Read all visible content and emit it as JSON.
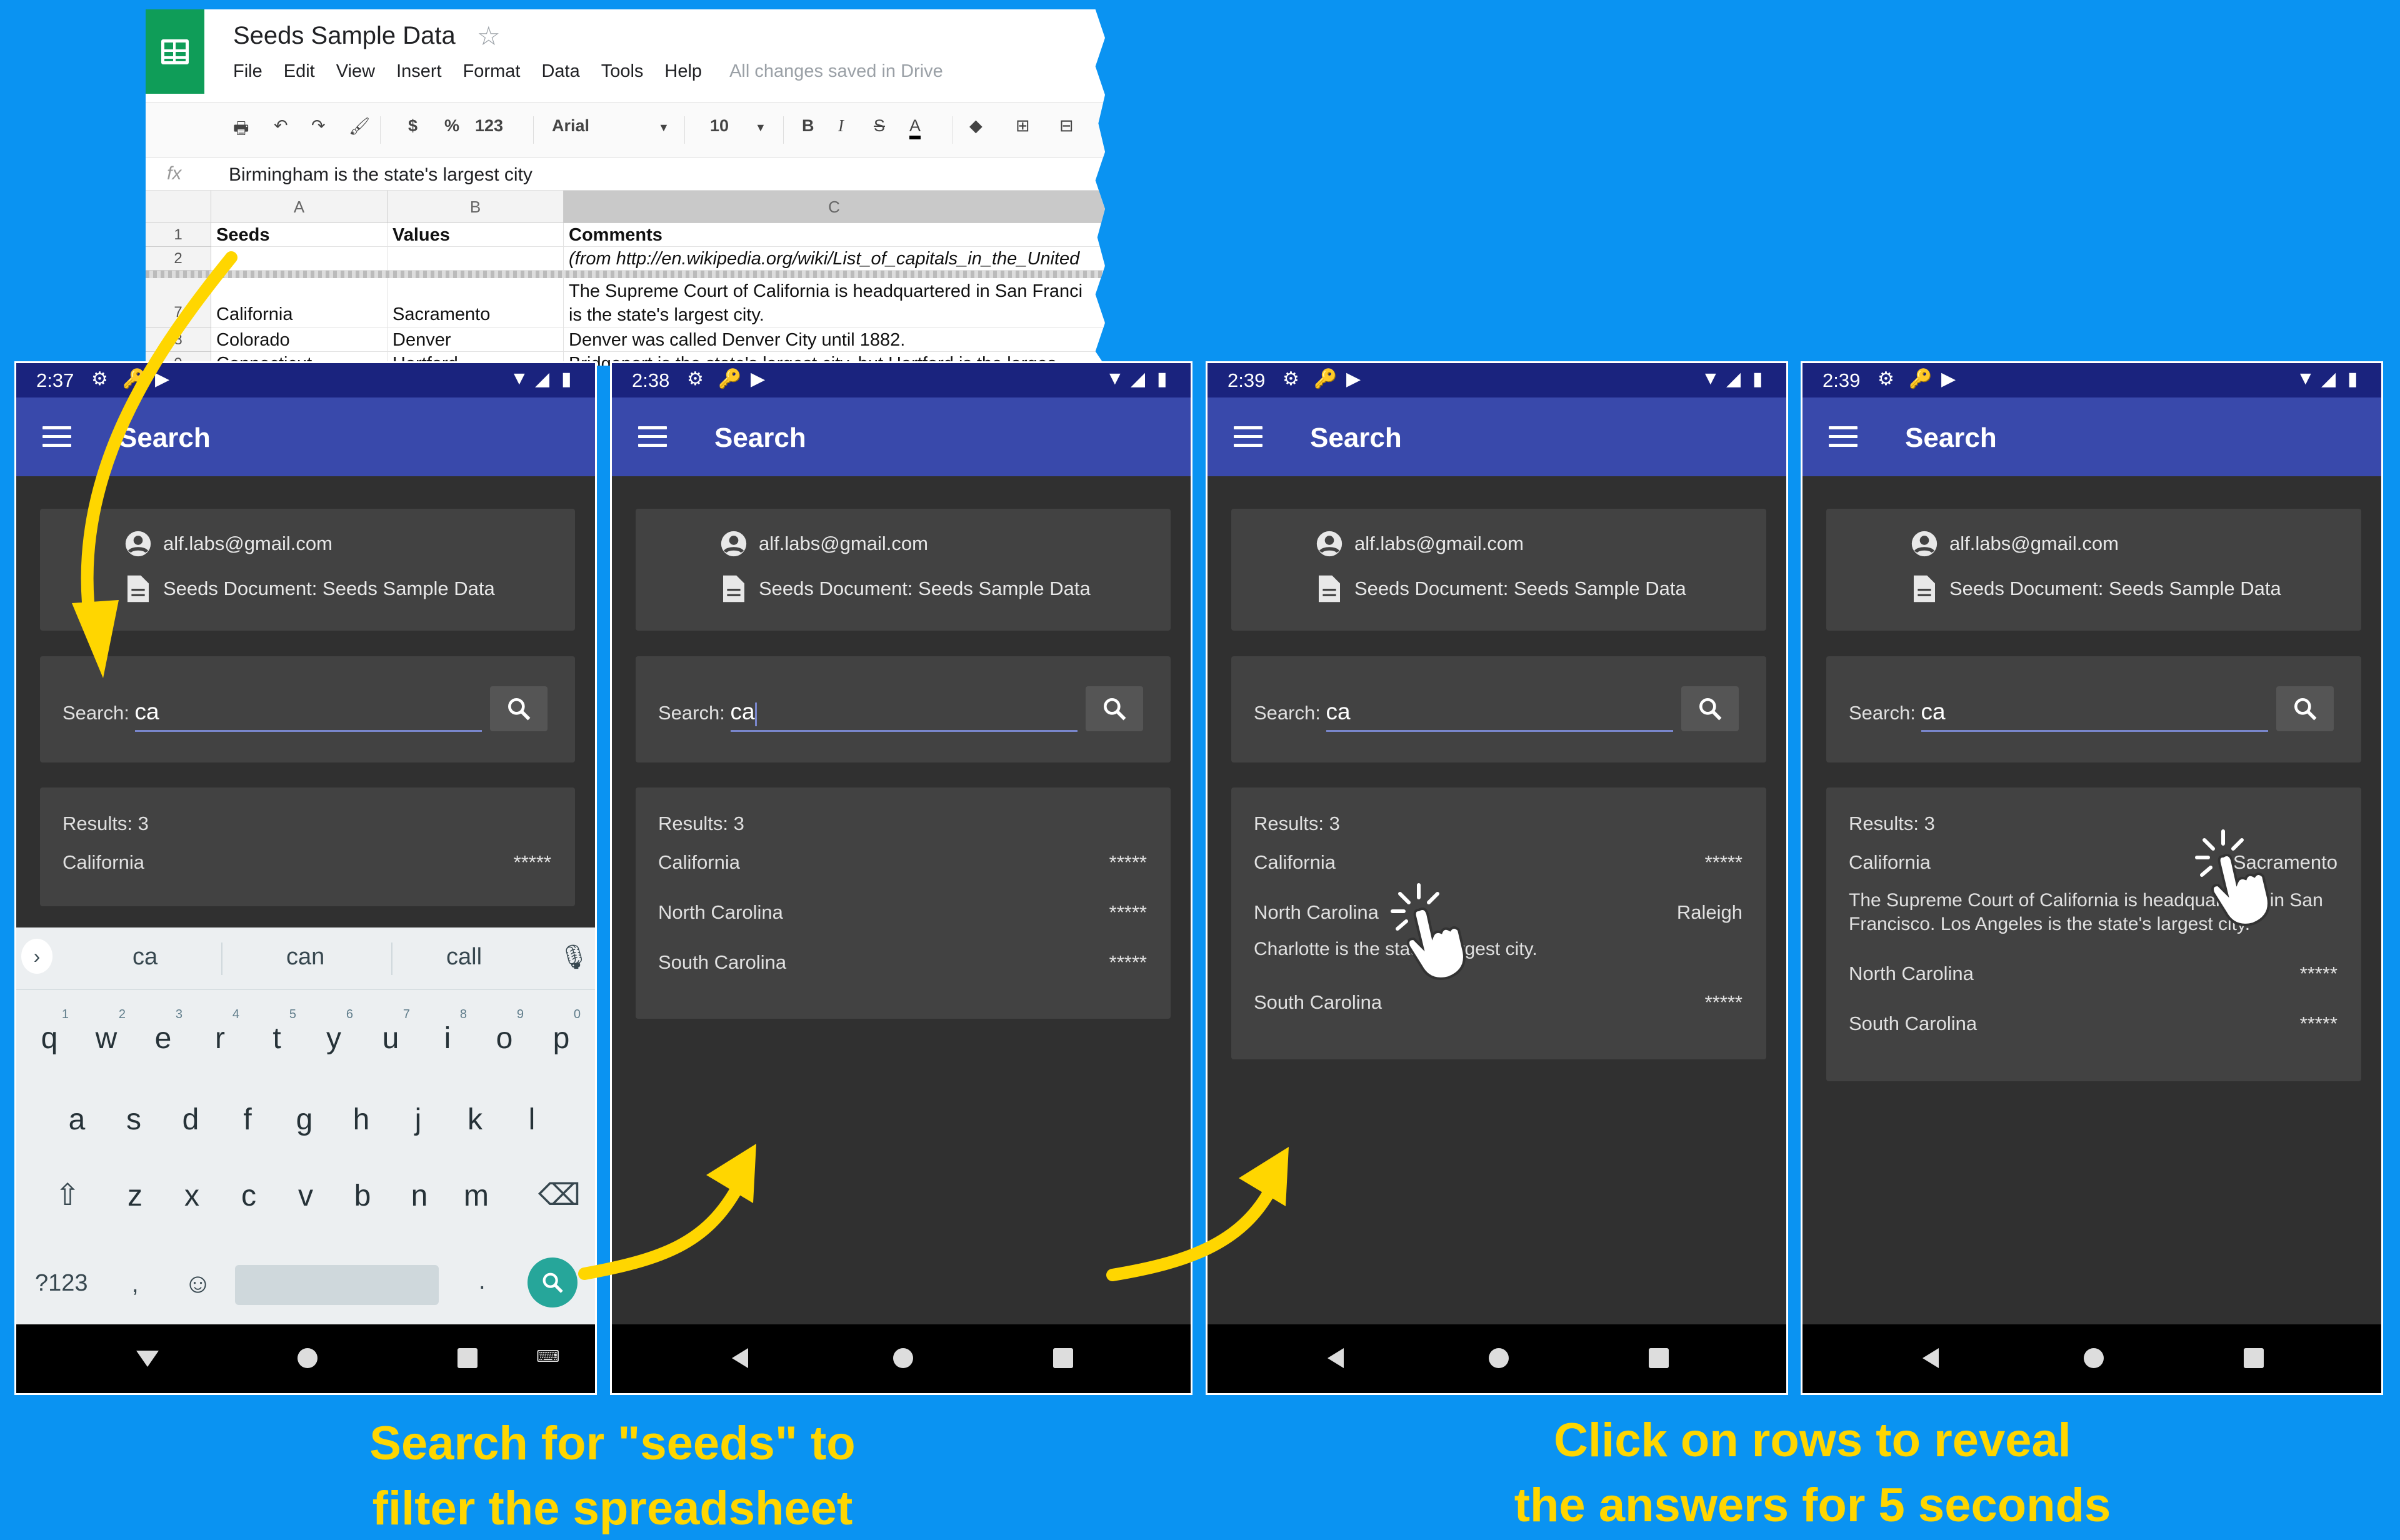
{
  "sheet": {
    "title": "Seeds Sample Data",
    "menu": [
      "File",
      "Edit",
      "View",
      "Insert",
      "Format",
      "Data",
      "Tools",
      "Help"
    ],
    "saved_status": "All changes saved in Drive",
    "toolbar": {
      "currency": "$",
      "percent": "%",
      "number_format": "123",
      "font": "Arial",
      "size": "10",
      "bold": "B",
      "italic": "I",
      "strike": "S",
      "text_color": "A"
    },
    "formula_bar": {
      "fx": "fx",
      "value": "Birmingham is the state's largest city"
    },
    "col_headers": [
      "A",
      "B",
      "C"
    ],
    "rows": [
      {
        "num": "1",
        "a": "Seeds",
        "b": "Values",
        "c": "Comments"
      },
      {
        "num": "2",
        "a": "",
        "b": "",
        "c": "(from http://en.wikipedia.org/wiki/List_of_capitals_in_the_United"
      },
      {
        "num": "7",
        "a": "California",
        "b": "Sacramento",
        "c": "The Supreme Court of California is headquartered in San Franci",
        "c2": "is the state's largest city."
      },
      {
        "num": "8",
        "a": "Colorado",
        "b": "Denver",
        "c": "Denver was called Denver City until 1882."
      },
      {
        "num": "9",
        "a": "Connecticut",
        "b": "Hartford",
        "c": "Bridgeport is the state's largest city, but Hartford is the larges"
      }
    ]
  },
  "phones": [
    {
      "time": "2:37",
      "app_title": "Search",
      "account": "alf.labs@gmail.com",
      "document": "Seeds Document: Seeds Sample Data",
      "search_label": "Search:",
      "search_value": "ca",
      "results_count": "Results: 3",
      "results": [
        {
          "name": "California",
          "value": "*****"
        }
      ],
      "keyboard": {
        "suggestions": [
          "ca",
          "can",
          "call"
        ],
        "row1": [
          "q",
          "w",
          "e",
          "r",
          "t",
          "y",
          "u",
          "i",
          "o",
          "p"
        ],
        "row1_nums": [
          "1",
          "2",
          "3",
          "4",
          "5",
          "6",
          "7",
          "8",
          "9",
          "0"
        ],
        "row2": [
          "a",
          "s",
          "d",
          "f",
          "g",
          "h",
          "j",
          "k",
          "l"
        ],
        "row3": [
          "z",
          "x",
          "c",
          "v",
          "b",
          "n",
          "m"
        ],
        "sym_key": "?123",
        "comma": ",",
        "period": "."
      }
    },
    {
      "time": "2:38",
      "app_title": "Search",
      "account": "alf.labs@gmail.com",
      "document": "Seeds Document: Seeds Sample Data",
      "search_label": "Search:",
      "search_value": "ca",
      "results_count": "Results: 3",
      "results": [
        {
          "name": "California",
          "value": "*****"
        },
        {
          "name": "North Carolina",
          "value": "*****"
        },
        {
          "name": "South Carolina",
          "value": "*****"
        }
      ]
    },
    {
      "time": "2:39",
      "app_title": "Search",
      "account": "alf.labs@gmail.com",
      "document": "Seeds Document: Seeds Sample Data",
      "search_label": "Search:",
      "search_value": "ca",
      "results_count": "Results: 3",
      "results": [
        {
          "name": "California",
          "value": "*****"
        },
        {
          "name": "North Carolina",
          "value": "Raleigh",
          "desc": "Charlotte is the state's largest city."
        },
        {
          "name": "South Carolina",
          "value": "*****"
        }
      ]
    },
    {
      "time": "2:39",
      "app_title": "Search",
      "account": "alf.labs@gmail.com",
      "document": "Seeds Document: Seeds Sample Data",
      "search_label": "Search:",
      "search_value": "ca",
      "results_count": "Results: 3",
      "results": [
        {
          "name": "California",
          "value": "Sacramento",
          "desc": "The Supreme Court of California is headquartered in San Francisco. Los Angeles is the state's largest city."
        },
        {
          "name": "North Carolina",
          "value": "*****"
        },
        {
          "name": "South Carolina",
          "value": "*****"
        }
      ]
    }
  ],
  "captions": {
    "left_line1": "Search for \"seeds\" to",
    "left_line2": "filter the spreadsheet",
    "right_line1": "Click on rows to reveal",
    "right_line2": "the answers for 5 seconds"
  },
  "colors": {
    "background": "#0A93F2",
    "appbar": "#3949AB",
    "statusbar": "#1A237E",
    "caption": "#FFD600",
    "arrow": "#FFD600",
    "sheets_green": "#0F9D58"
  }
}
